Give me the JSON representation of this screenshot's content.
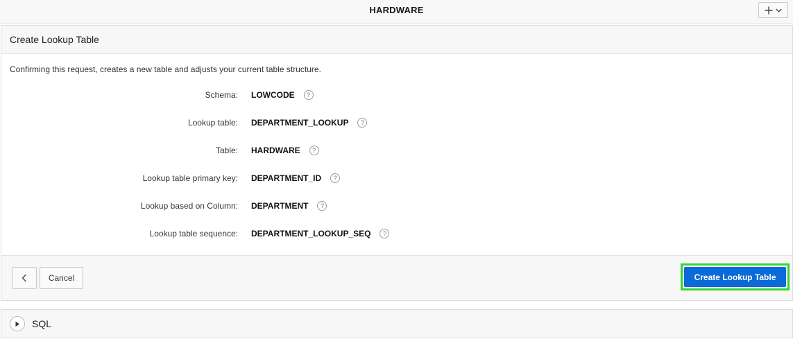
{
  "topbar": {
    "title": "HARDWARE",
    "add_icon": "plus-icon",
    "menu_icon": "chevron-down-icon"
  },
  "panel": {
    "title": "Create Lookup Table",
    "description": "Confirming this request, creates a new table and adjusts your current table structure.",
    "fields": [
      {
        "label": "Schema:",
        "value": "LOWCODE"
      },
      {
        "label": "Lookup table:",
        "value": "DEPARTMENT_LOOKUP"
      },
      {
        "label": "Table:",
        "value": "HARDWARE"
      },
      {
        "label": "Lookup table primary key:",
        "value": "DEPARTMENT_ID"
      },
      {
        "label": "Lookup based on Column:",
        "value": "DEPARTMENT"
      },
      {
        "label": "Lookup table sequence:",
        "value": "DEPARTMENT_LOOKUP_SEQ"
      }
    ],
    "help_glyph": "?"
  },
  "footer": {
    "back_icon": "chevron-left-icon",
    "cancel_label": "Cancel",
    "primary_label": "Create Lookup Table",
    "primary_color": "#0a6ad8",
    "highlight_color": "#33d633"
  },
  "sql_region": {
    "label": "SQL",
    "toggle_icon": "play-triangle-icon"
  }
}
